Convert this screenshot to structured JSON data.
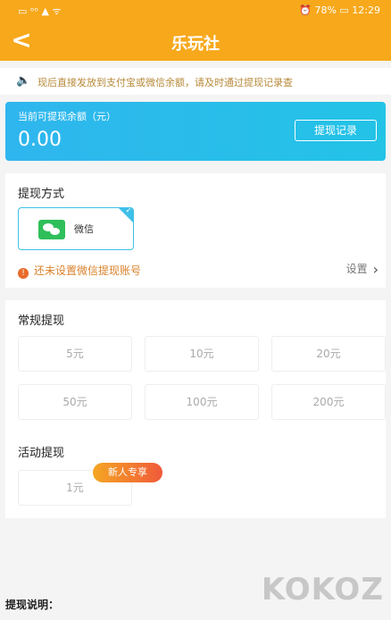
{
  "statusbar": {
    "left": "▭ ᵒᵒ ▲ ᯤ",
    "right": "⏰ 78% ▭ 12:29"
  },
  "navbar": {
    "back": "<",
    "title": "乐玩社"
  },
  "notice": {
    "icon": "speaker-icon",
    "text": "现后直接发放到支付宝或微信余额，请及时通过提现记录查"
  },
  "balance": {
    "label": "当前可提现余额（元）",
    "amount": "0.00",
    "record_button": "提现记录"
  },
  "withdraw_method": {
    "heading": "提现方式",
    "option": {
      "name": "微信",
      "icon": "wechat-icon",
      "selected": true
    },
    "warning": "还未设置微信提现账号",
    "setup": "设置"
  },
  "regular": {
    "heading": "常规提现",
    "amounts": [
      "5元",
      "10元",
      "20元",
      "50元",
      "100元",
      "200元"
    ]
  },
  "activity": {
    "heading": "活动提现",
    "amount": "1元",
    "badge": "新人专享"
  },
  "explain": {
    "title": "提现说明："
  },
  "watermark": "KOKOZ",
  "colors": {
    "brand": "#f7a81b",
    "accent": "#2fb6ee",
    "warning": "#e96a2a"
  }
}
